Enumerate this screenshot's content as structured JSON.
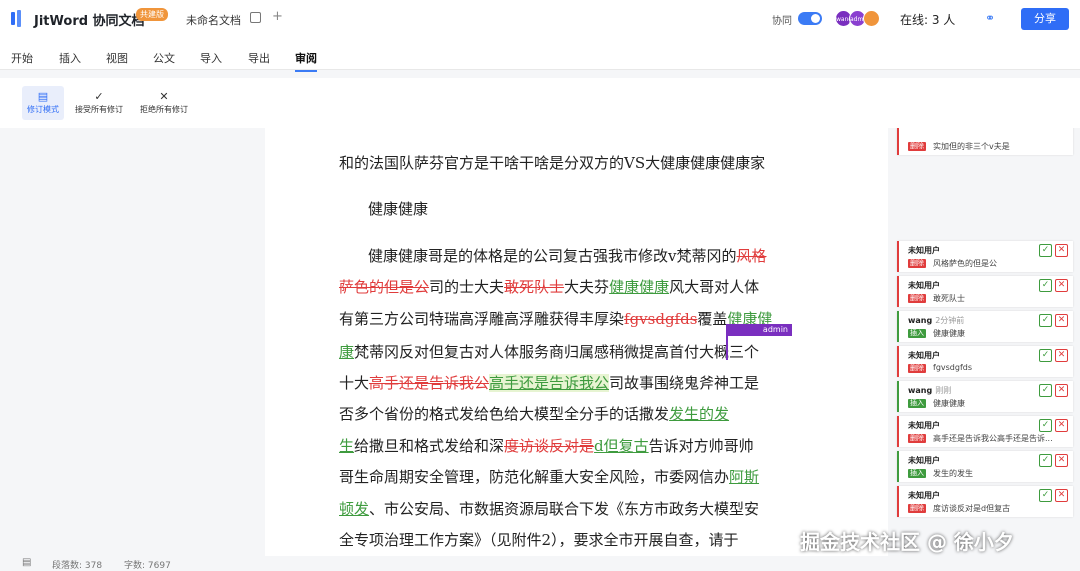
{
  "header": {
    "brand": "JitWord 协同文档",
    "badge": "共建版",
    "doc_name": "未命名文档",
    "collab_label": "协同",
    "avatars": [
      {
        "label": "wang",
        "color": "#7a2fbf"
      },
      {
        "label": "admin",
        "color": "#8a3fd0"
      },
      {
        "label": "",
        "color": "#f0953b"
      }
    ],
    "online": "在线: 3 人",
    "share": "分享"
  },
  "menu": [
    "开始",
    "插入",
    "视图",
    "公文",
    "导入",
    "导出",
    "审阅"
  ],
  "toolbar": {
    "revision_mode": "修订模式",
    "accept_all": "接受所有修订",
    "reject_all": "拒绝所有修订"
  },
  "document": {
    "line0_a": "和的法国队萨芬官方是干啥干啥是分双方的VS大健康健康健康家",
    "line1_a": "健康健康",
    "line2_a": "健康健康哥是的体格是的公司复古强我市修改v梵蒂冈的",
    "line2_del": "风格",
    "line3_del1": "萨色的但是公",
    "line3_a": "司的士大夫",
    "line3_del2": "敢死队士",
    "line3_b": "大夫芬",
    "line3_ins": "健康健康",
    "line3_c": "风大哥对人体",
    "line4_a": "有第三方公司特瑞高浮雕高浮雕获得丰厚染",
    "line4_del": "fgvsdgfds",
    "line4_b": "覆盖",
    "line4_ins": "健康健",
    "line5_ins": "康",
    "line5_a": "梵蒂冈反对但复古对人体服务商归属感稍微提高首付大概三个",
    "line6_a": "十大",
    "line6_del": "高手还是告诉我公",
    "line6_ins": "高手还是告诉我公",
    "line6_b": "司故事围绕鬼斧神工是",
    "line7_a": "否多个省份的格式发给色给大模型全分手的话撒发",
    "line7_ins": "发生的发",
    "line8_ins": "生",
    "line8_a": "给撒旦和格式发给和深",
    "line8_del": "度访谈反对是",
    "line8_ins2": "d但复古",
    "line8_b": "告诉对方帅哥帅",
    "line9_a": "哥生命周期安全管理，防范化解重大安全风险，市委网信办",
    "line9_ins": "阿斯",
    "line10_ins": "顿发",
    "line10_a": "、市公安局、市数据资源局联合下发《东方市政务大模型安",
    "line11_a": "全专项治理工作方案》（见附件2），要求全市开展自查，请于",
    "cursor_user": "admin"
  },
  "revisions": [
    {
      "user": "",
      "time": "",
      "type": "删除",
      "text": "实加但的非三个v夫是",
      "kind": "del"
    },
    {
      "user": "未知用户",
      "time": "",
      "type": "删除",
      "text": "风格萨色的但是公",
      "kind": "del"
    },
    {
      "user": "未知用户",
      "time": "",
      "type": "删除",
      "text": "敢死队士",
      "kind": "del"
    },
    {
      "user": "wang",
      "time": "2分钟前",
      "type": "插入",
      "text": "健康健康",
      "kind": "ins"
    },
    {
      "user": "未知用户",
      "time": "",
      "type": "删除",
      "text": "fgvsdgfds",
      "kind": "del"
    },
    {
      "user": "wang",
      "time": "刚刚",
      "type": "插入",
      "text": "健康健康",
      "kind": "ins"
    },
    {
      "user": "未知用户",
      "time": "",
      "type": "删除",
      "text": "高手还是告诉我公高手还是告诉...",
      "kind": "del"
    },
    {
      "user": "未知用户",
      "time": "",
      "type": "插入",
      "text": "发生的发生",
      "kind": "ins"
    },
    {
      "user": "未知用户",
      "time": "",
      "type": "删除",
      "text": "度访谈反对是d但复古",
      "kind": "del"
    }
  ],
  "status": {
    "paragraphs": "段落数: 378",
    "chars": "字数: 7697"
  },
  "watermark": "掘金技术社区 @ 徐小夕"
}
